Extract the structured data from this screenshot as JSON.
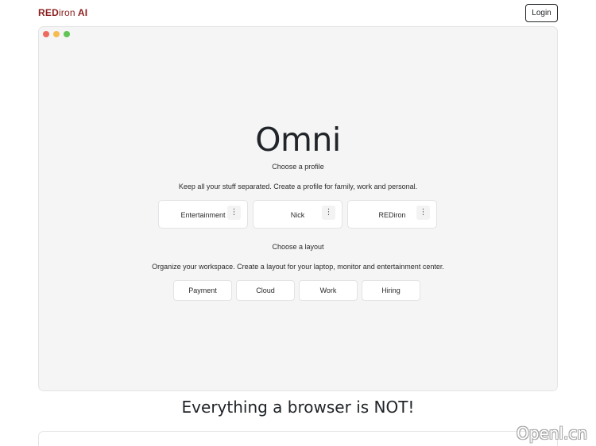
{
  "nav": {
    "brand_bold": "RED",
    "brand_light": "iron",
    "brand_suffix": " AI",
    "login_label": "Login"
  },
  "hero": {
    "title": "Omni",
    "profile_heading": "Choose a profile",
    "profile_desc": "Keep all your stuff separated. Create a profile for family, work and personal.",
    "profiles": [
      {
        "label": "Entertainment"
      },
      {
        "label": "Nick"
      },
      {
        "label": "REDiron"
      }
    ],
    "layout_heading": "Choose a layout",
    "layout_desc": "Organize your workspace. Create a layout for your laptop, monitor and entertainment center.",
    "layouts": [
      {
        "label": "Payment"
      },
      {
        "label": "Cloud"
      },
      {
        "label": "Work"
      },
      {
        "label": "Hiring"
      }
    ]
  },
  "tagline": "Everything a browser is NOT!",
  "watermark": "Openl.cn",
  "colors": {
    "brand": "#8b1d1d",
    "window_bg": "#f5f5f6",
    "dot_red": "#ee6a5f",
    "dot_yellow": "#f5bd4f",
    "dot_green": "#61c454"
  }
}
